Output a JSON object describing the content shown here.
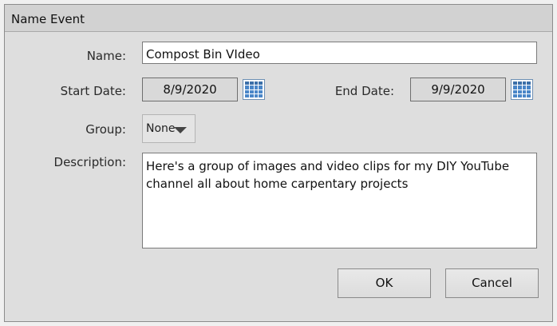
{
  "dialog": {
    "title": "Name Event"
  },
  "form": {
    "name_label": "Name:",
    "name_value": "Compost Bin VIdeo",
    "start_date_label": "Start Date:",
    "start_date_value": "8/9/2020",
    "end_date_label": "End Date:",
    "end_date_value": "9/9/2020",
    "group_label": "Group:",
    "group_selected": "None",
    "description_label": "Description:",
    "description_value": "Here's a group of images and video clips for my DIY YouTube channel all about home carpentary projects"
  },
  "buttons": {
    "ok_label": "OK",
    "cancel_label": "Cancel"
  },
  "icons": {
    "date_picker": "calendar-grid-icon",
    "dropdown": "caret-down-icon"
  }
}
